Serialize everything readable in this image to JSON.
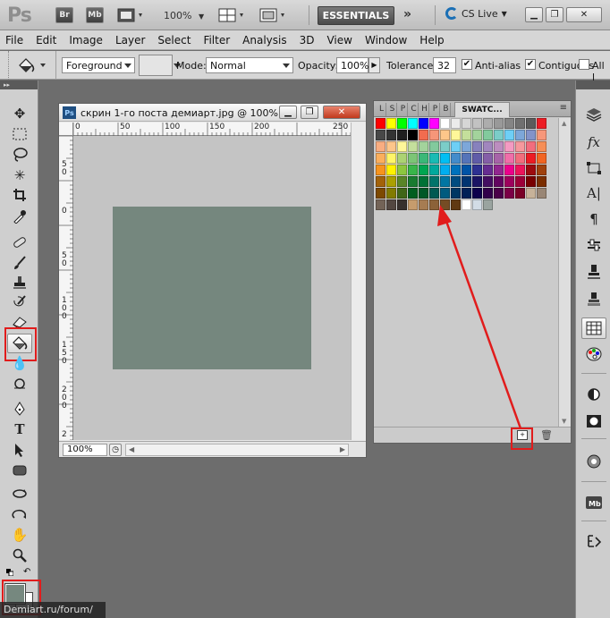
{
  "appbar": {
    "logo": "Ps",
    "bridge_label": "Br",
    "minibridge_label": "Mb",
    "zoom_level": "100%",
    "workspace_label": "ESSENTIALS",
    "more_workspaces": "»",
    "cslive_label": "CS Live"
  },
  "menubar": {
    "items": [
      "File",
      "Edit",
      "Image",
      "Layer",
      "Select",
      "Filter",
      "Analysis",
      "3D",
      "View",
      "Window",
      "Help"
    ]
  },
  "options": {
    "fill_source": "Foreground",
    "mode_label": "Mode:",
    "mode_value": "Normal",
    "opacity_label": "Opacity:",
    "opacity_value": "100%",
    "tolerance_label": "Tolerance:",
    "tolerance_value": "32",
    "antialias_label": "Anti-alias",
    "contiguous_label": "Contiguous",
    "all_layers_label": "All l"
  },
  "document": {
    "title": "скрин 1-го поста демиарт.jpg @ 100% ...",
    "zoom": "100%",
    "ruler_h_labels": [
      "0",
      "50",
      "100",
      "150",
      "200",
      "250"
    ],
    "ruler_v_labels": [
      "5 0",
      "0",
      "5 0",
      "1 0 0",
      "1 5 0",
      "2 0 0",
      "2"
    ],
    "canvas_color": "#75877e"
  },
  "swatches": {
    "collapsed_tabs": [
      "L",
      "S",
      "P",
      "C",
      "H",
      "P",
      "B"
    ],
    "active_tab": "SWATC...",
    "rows": [
      [
        "#ff0000",
        "#ffff00",
        "#00ff00",
        "#00ffff",
        "#0000ff",
        "#ff00ff",
        "#ffffff",
        "#ebebeb",
        "#d6d6d6",
        "#c2c2c2",
        "#adadad",
        "#999999",
        "#858585",
        "#707070",
        "#5c5c5c",
        "#ed1c24"
      ],
      [
        "#474747",
        "#333333",
        "#1f1f1f",
        "#000000",
        "#f26c4f",
        "#f69679",
        "#fdc68a",
        "#fff799",
        "#c4df9b",
        "#a3d39c",
        "#82ca9d",
        "#7bcdc8",
        "#6ecff6",
        "#7da7d9",
        "#8393ca",
        "#f7977a"
      ],
      [
        "#f9ad81",
        "#fdc68a",
        "#fff799",
        "#c4df9c",
        "#a3d39c",
        "#82ca9d",
        "#7bcdc8",
        "#6dcff6",
        "#7da7d9",
        "#8781bd",
        "#a186be",
        "#bc8dbf",
        "#f49ac2",
        "#f6989d",
        "#f26d7d",
        "#f68e56"
      ],
      [
        "#fbaf5d",
        "#fff568",
        "#acd373",
        "#7cc576",
        "#3bb878",
        "#1abbb4",
        "#00bff3",
        "#438ccb",
        "#5574b9",
        "#605ca8",
        "#855fa8",
        "#a763a8",
        "#f06ea9",
        "#f26d7d",
        "#ed1c24",
        "#f26522"
      ],
      [
        "#f7941d",
        "#fff200",
        "#8dc63f",
        "#39b54a",
        "#00a651",
        "#00a99d",
        "#00aeef",
        "#0072bc",
        "#0054a6",
        "#2e3192",
        "#662d91",
        "#92278f",
        "#ec008c",
        "#ed145b",
        "#9e0b0f",
        "#a0410d"
      ],
      [
        "#a36209",
        "#aba000",
        "#598527",
        "#197b30",
        "#007236",
        "#00746b",
        "#0076a3",
        "#004b80",
        "#003471",
        "#1b1464",
        "#440e62",
        "#630460",
        "#9e005d",
        "#9e0039",
        "#790000",
        "#7b2e00"
      ],
      [
        "#7d4900",
        "#827b00",
        "#406618",
        "#005e20",
        "#005826",
        "#005952",
        "#005b7f",
        "#003663",
        "#002157",
        "#0d004c",
        "#32004b",
        "#4b0049",
        "#7b0046",
        "#7a0026",
        "#c7b299",
        "#998675"
      ],
      [
        "#736357",
        "#534741",
        "#37302d",
        "#c69c6d",
        "#a67c52",
        "#8c6239",
        "#754c24",
        "#603913",
        "#ffffff",
        "#d2dce6",
        "#9aa4a0"
      ]
    ]
  },
  "watermark": "Demiart.ru/forum/"
}
